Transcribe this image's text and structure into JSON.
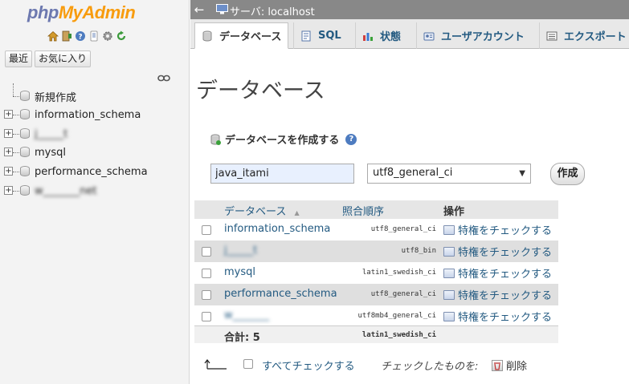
{
  "nav": {
    "logo_php": "php",
    "logo_myadmin": "MyAdmin",
    "icons": [
      "home-icon",
      "exit-icon",
      "help-icon",
      "docs-icon",
      "settings-icon",
      "reload-icon"
    ],
    "recent_label": "最近",
    "favorites_label": "お気に入り",
    "new_label": "新規作成",
    "databases": [
      {
        "name": "information_schema",
        "blurred": false
      },
      {
        "name": "j_____t",
        "blurred": true
      },
      {
        "name": "mysql",
        "blurred": false
      },
      {
        "name": "performance_schema",
        "blurred": false
      },
      {
        "name": "w_______net",
        "blurred": true
      }
    ]
  },
  "topbar": {
    "server_label": "サーバ: localhost"
  },
  "tabs": [
    {
      "label": "データベース",
      "icon": "database-icon",
      "active": true
    },
    {
      "label": "SQL",
      "icon": "sql-icon",
      "active": false
    },
    {
      "label": "状態",
      "icon": "status-icon",
      "active": false
    },
    {
      "label": "ユーザアカウント",
      "icon": "users-icon",
      "active": false
    },
    {
      "label": "エクスポート",
      "icon": "export-icon",
      "active": false
    }
  ],
  "main": {
    "title": "データベース",
    "create": {
      "label": "データベースを作成する",
      "name_value": "java_itami",
      "collation_value": "utf8_general_ci",
      "button_label": "作成"
    },
    "table": {
      "headers": {
        "database": "データベース",
        "sort_arrow": "▲",
        "collation": "照合順序",
        "action": "操作"
      },
      "rows": [
        {
          "name": "information_schema",
          "collation": "utf8_general_ci",
          "action": "特権をチェックする",
          "blurred": false
        },
        {
          "name": "j_____t",
          "collation": "utf8_bin",
          "action": "特権をチェックする",
          "blurred": true
        },
        {
          "name": "mysql",
          "collation": "latin1_swedish_ci",
          "action": "特権をチェックする",
          "blurred": false
        },
        {
          "name": "performance_schema",
          "collation": "utf8_general_ci",
          "action": "特権をチェックする",
          "blurred": false
        },
        {
          "name": "w_______",
          "collation": "utf8mb4_general_ci",
          "action": "特権をチェックする",
          "blurred": true
        }
      ],
      "total_label": "合計: 5",
      "total_collation": "latin1_swedish_ci"
    },
    "bottom": {
      "check_all_label": "すべてチェックする",
      "with_selected_label": "チェックしたものを:",
      "delete_label": "削除"
    }
  }
}
